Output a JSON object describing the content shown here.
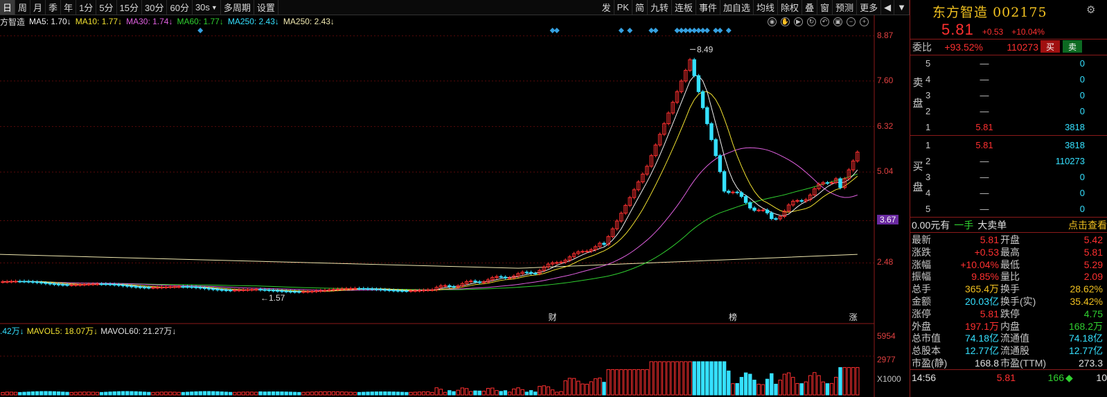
{
  "toolbar": {
    "periods": [
      "日",
      "周",
      "月",
      "季",
      "年",
      "1分",
      "5分",
      "15分",
      "30分",
      "60分"
    ],
    "active_period": "日",
    "dropdown_value": "30s",
    "multi_period": "多周期",
    "settings": "设置",
    "right_tools": [
      "发",
      "PK",
      "简",
      "九转",
      "连板",
      "事件",
      "加自选",
      "均线",
      "除权",
      "叠",
      "窗",
      "预测",
      "更多"
    ]
  },
  "infoline": {
    "stock_name": "方智造",
    "ma": [
      {
        "label": "MA5: 1.70↓",
        "color": "#f0f0f0"
      },
      {
        "label": "MA10: 1.77↓",
        "color": "#f0e030"
      },
      {
        "label": "MA30: 1.74↓",
        "color": "#e060e0"
      },
      {
        "label": "MA60: 1.77↓",
        "color": "#30d030"
      },
      {
        "label": "MA250: 2.43↓",
        "color": "#35e0ff"
      },
      {
        "label": "MA250: 2.43↓",
        "color": "#f0e8b0"
      }
    ]
  },
  "price_axis": {
    "labels": [
      "8.87",
      "7.60",
      "6.32",
      "5.04",
      "3.67",
      "2.48"
    ],
    "highlight": "3.67"
  },
  "chart_marks": {
    "high_label": "8.49",
    "low_label": "1.57",
    "event_labels": [
      "财",
      "榜",
      "涨"
    ]
  },
  "volume": {
    "header": [
      {
        "label": ".42万↓",
        "color": "#35e0ff"
      },
      {
        "label": "MAVOL5: 18.07万↓",
        "color": "#f0e030"
      },
      {
        "label": "MAVOL60: 21.27万↓",
        "color": "#e0e0e0"
      }
    ],
    "axis_labels": [
      "5954",
      "2977",
      "X1000"
    ]
  },
  "chart_data": {
    "type": "candlestick",
    "ylim": [
      1.3,
      9.1
    ],
    "price_axis_ticks": [
      8.87,
      7.6,
      6.32,
      5.04,
      3.67,
      2.48
    ],
    "high": 8.49,
    "low": 1.57,
    "last_close": 5.81,
    "volume_axis_ticks": [
      5954,
      2977
    ],
    "volume_unit": "X1000"
  },
  "panel": {
    "name": "东方智造",
    "code": "002175",
    "price": "5.81",
    "change": "+0.53",
    "change_pct": "+10.04%",
    "weibi_label": "委比",
    "weibi": "+93.52%",
    "weicha": "110273",
    "buy_btn": "买",
    "sell_btn": "卖",
    "sell_side_label": "卖盘",
    "buy_side_label": "买盘",
    "sell_rows": [
      {
        "level": "5",
        "price": "—",
        "vol": "0"
      },
      {
        "level": "4",
        "price": "—",
        "vol": "0"
      },
      {
        "level": "3",
        "price": "—",
        "vol": "0"
      },
      {
        "level": "2",
        "price": "—",
        "vol": "0"
      },
      {
        "level": "1",
        "price": "5.81",
        "vol": "3818"
      }
    ],
    "buy_rows": [
      {
        "level": "1",
        "price": "5.81",
        "vol": "3818"
      },
      {
        "level": "2",
        "price": "—",
        "vol": "110273"
      },
      {
        "level": "3",
        "price": "—",
        "vol": "0"
      },
      {
        "level": "4",
        "price": "—",
        "vol": "0"
      },
      {
        "level": "5",
        "price": "—",
        "vol": "0"
      }
    ],
    "trade_bar": {
      "amount": "0.00元有",
      "hand": "一手",
      "big": "大卖单",
      "link": "点击查看"
    },
    "stats": [
      {
        "k": "最新",
        "v": "5.81",
        "vc": "red",
        "k2": "开盘",
        "v2": "5.42",
        "v2c": "red"
      },
      {
        "k": "涨跌",
        "v": "+0.53",
        "vc": "red",
        "k2": "最高",
        "v2": "5.81",
        "v2c": "red"
      },
      {
        "k": "涨幅",
        "v": "+10.04%",
        "vc": "red",
        "k2": "最低",
        "v2": "5.29",
        "v2c": "red"
      },
      {
        "k": "振幅",
        "v": "9.85%",
        "vc": "red",
        "k2": "量比",
        "v2": "2.09",
        "v2c": "red"
      },
      {
        "k": "总手",
        "v": "365.4万",
        "vc": "yellow",
        "k2": "换手",
        "v2": "28.62%",
        "v2c": "yellow"
      },
      {
        "k": "金额",
        "v": "20.03亿",
        "vc": "cyan",
        "k2": "换手(实)",
        "v2": "35.42%",
        "v2c": "yellow"
      },
      {
        "k": "涨停",
        "v": "5.81",
        "vc": "red",
        "k2": "跌停",
        "v2": "4.75",
        "v2c": "green"
      },
      {
        "k": "外盘",
        "v": "197.1万",
        "vc": "red",
        "k2": "内盘",
        "v2": "168.2万",
        "v2c": "green"
      },
      {
        "k": "总市值",
        "v": "74.18亿",
        "vc": "cyan",
        "k2": "流通值",
        "v2": "74.18亿",
        "v2c": "cyan"
      },
      {
        "k": "总股本",
        "v": "12.77亿",
        "vc": "cyan",
        "k2": "流通股",
        "v2": "12.77亿",
        "v2c": "cyan"
      },
      {
        "k": "市盈(静)",
        "v": "168.8",
        "vc": "white",
        "k2": "市盈(TTM)",
        "v2": "273.3",
        "v2c": "white"
      }
    ],
    "tick": {
      "time": "14:56",
      "price": "5.81",
      "vol": "166",
      "extra": "10"
    }
  }
}
